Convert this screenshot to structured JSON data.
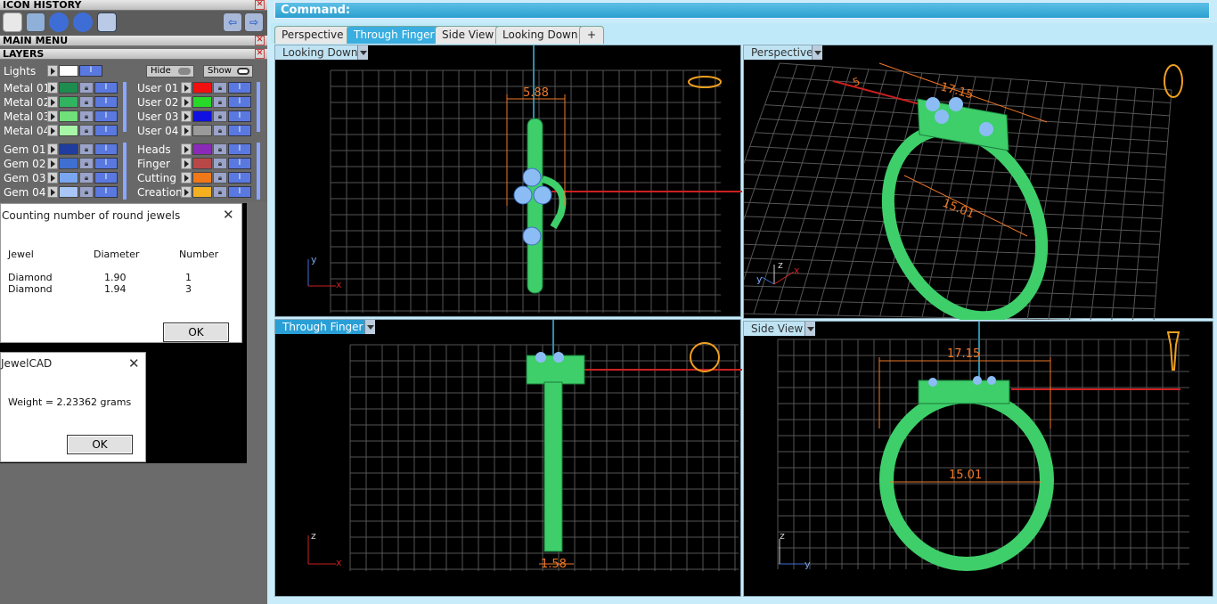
{
  "left_panel": {
    "icon_history": "ICON HISTORY",
    "main_menu": "MAIN MENU",
    "layers_title": "LAYERS",
    "lights_label": "Lights",
    "hide_label": "Hide",
    "show_label": "Show",
    "layers_left": [
      {
        "name": "Metal 01",
        "color": "#1e8b4f"
      },
      {
        "name": "Metal 02",
        "color": "#31b45f"
      },
      {
        "name": "Metal 03",
        "color": "#6fe07a"
      },
      {
        "name": "Metal 04",
        "color": "#a8f5a8"
      },
      {
        "name": "Gem 01",
        "color": "#1f3c9e"
      },
      {
        "name": "Gem 02",
        "color": "#3f6fd0"
      },
      {
        "name": "Gem 03",
        "color": "#7aa6f0"
      },
      {
        "name": "Gem 04",
        "color": "#a9c6f7"
      }
    ],
    "layers_right": [
      {
        "name": "User 01",
        "color": "#f01010"
      },
      {
        "name": "User 02",
        "color": "#28d828"
      },
      {
        "name": "User 03",
        "color": "#1010e0"
      },
      {
        "name": "User 04",
        "color": "#9a9a9a"
      },
      {
        "name": "Heads",
        "color": "#8a2ab8"
      },
      {
        "name": "Finger",
        "color": "#b84848"
      },
      {
        "name": "Cutting",
        "color": "#f07818"
      },
      {
        "name": "Creation",
        "color": "#f5b020"
      }
    ]
  },
  "jewels_dialog": {
    "title": "Counting number of round jewels",
    "col_jewel": "Jewel",
    "col_diameter": "Diameter",
    "col_number": "Number",
    "rows": [
      {
        "jewel": "Diamond",
        "diameter": "1.90",
        "number": "1"
      },
      {
        "jewel": "Diamond",
        "diameter": "1.94",
        "number": "3"
      }
    ],
    "ok": "OK",
    "close": "✕"
  },
  "weight_dialog": {
    "title": "JewelCAD",
    "message": "Weight = 2.23362 grams",
    "ok": "OK",
    "close": "✕"
  },
  "command_label": "Command:",
  "tabs": [
    {
      "label": "Perspective",
      "active": false
    },
    {
      "label": "Through Finger",
      "active": true
    },
    {
      "label": "Side View",
      "active": false
    },
    {
      "label": "Looking Down",
      "active": false
    }
  ],
  "tab_add": "+",
  "viewports": {
    "top_left": {
      "label": "Looking Down",
      "dimension": "5.88",
      "axis_v": "y",
      "axis_h": "x"
    },
    "top_right": {
      "label": "Perspective",
      "dim_width": "17.15",
      "dim_inner": "15.01",
      "dim_small": "5",
      "axis_v": "z",
      "axis_h": "x",
      "axis_d": "y"
    },
    "bottom_left": {
      "label": "Through Finger",
      "dimension": "1.58",
      "axis_v": "z",
      "axis_h": "x"
    },
    "bottom_right": {
      "label": "Side View",
      "dim_width": "17.15",
      "dim_inner": "15.01",
      "axis_v": "z",
      "axis_h": "y"
    }
  },
  "colors": {
    "ring": "#3ecf6a",
    "gem": "#8cbcf4",
    "dimension": "#f07828",
    "grid": "#5a5a5a",
    "axis": "#e02020"
  }
}
